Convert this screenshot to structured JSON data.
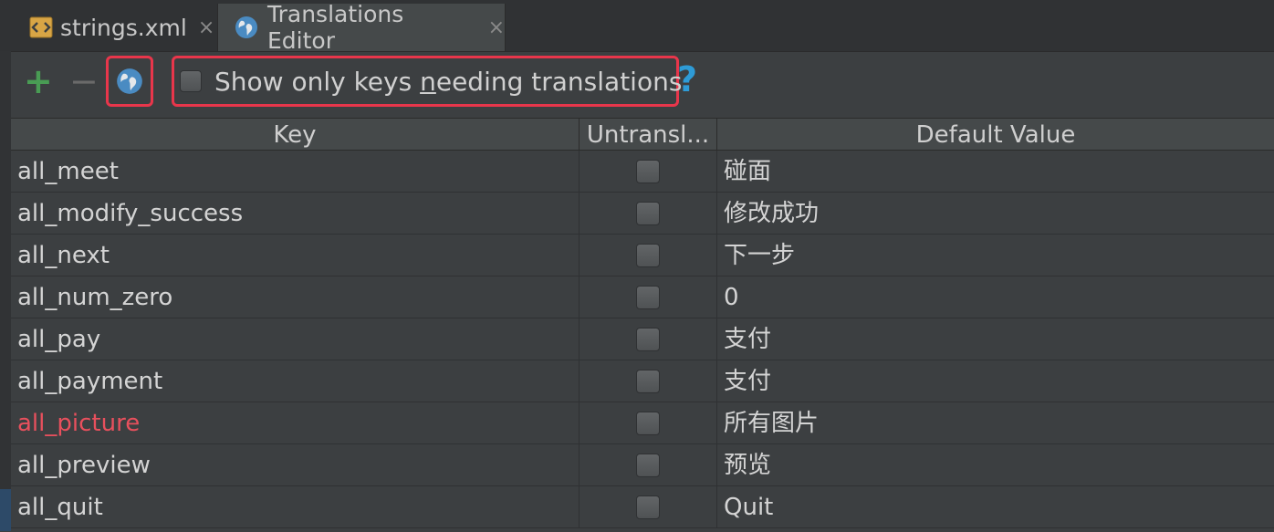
{
  "tabs": [
    {
      "label": "strings.xml",
      "close": "×",
      "icon": "xml-file-icon"
    },
    {
      "label": "Translations Editor",
      "close": "×",
      "icon": "globe-icon"
    }
  ],
  "toolbar": {
    "add_label": "+",
    "remove_label": "−",
    "filter_label_pre": "Show only keys ",
    "filter_label_mnemonic": "n",
    "filter_label_post": "eeding translations",
    "help_label": "?",
    "filter_checked": false
  },
  "table": {
    "columns": [
      "Key",
      "Untransl...",
      "Default Value"
    ],
    "rows": [
      {
        "key": "all_meet",
        "untranslatable": false,
        "default": "碰面",
        "warn": false
      },
      {
        "key": "all_modify_success",
        "untranslatable": false,
        "default": "修改成功",
        "warn": false
      },
      {
        "key": "all_next",
        "untranslatable": false,
        "default": "下一步",
        "warn": false
      },
      {
        "key": "all_num_zero",
        "untranslatable": false,
        "default": "0",
        "warn": false
      },
      {
        "key": "all_pay",
        "untranslatable": false,
        "default": "支付",
        "warn": false
      },
      {
        "key": "all_payment",
        "untranslatable": false,
        "default": "支付",
        "warn": false
      },
      {
        "key": "all_picture",
        "untranslatable": false,
        "default": "所有图片",
        "warn": true
      },
      {
        "key": "all_preview",
        "untranslatable": false,
        "default": "预览",
        "warn": false
      },
      {
        "key": "all_quit",
        "untranslatable": false,
        "default": "Quit",
        "warn": false
      }
    ]
  },
  "colors": {
    "warn_key": "#e8505d",
    "highlight_border": "#e8364b",
    "add_green": "#499c54",
    "help_blue": "#2e9bd6"
  }
}
